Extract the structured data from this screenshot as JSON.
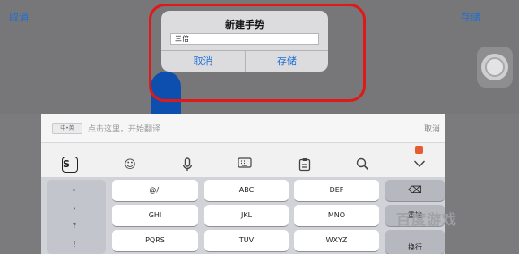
{
  "nav": {
    "cancel": "取消",
    "save": "存储"
  },
  "dialog": {
    "title": "新建手势",
    "input_value": "三倍",
    "cancel": "取消",
    "save": "存储"
  },
  "keyboard": {
    "lang_toggle": "中•英",
    "search_placeholder": "点击这里，开始翻译",
    "cancel": "取消",
    "toolbar_icons": [
      "sogou-icon",
      "emoji-icon",
      "microphone-icon",
      "keyboard-icon",
      "clipboard-icon",
      "search-icon",
      "collapse-icon"
    ],
    "punct": [
      "。",
      "，",
      "？",
      "！"
    ],
    "keys_row1": [
      "@/.",
      "ABC",
      "DEF"
    ],
    "keys_row2": [
      "GHI",
      "JKL",
      "MNO"
    ],
    "keys_row3": [
      "PQRS",
      "TUV",
      "WXYZ"
    ],
    "right_keys": {
      "delete": "⌫",
      "reenter": "重输",
      "newline": "换行"
    }
  },
  "watermark": "百度游戏",
  "colors": {
    "accent": "#1f6fd6",
    "annotation": "#e01818"
  }
}
